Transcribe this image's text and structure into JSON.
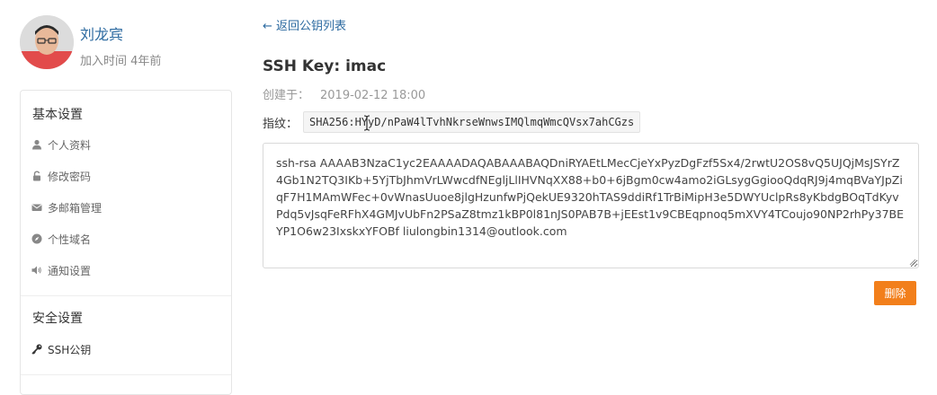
{
  "user": {
    "name": "刘龙宾",
    "joined": "加入时间 4年前"
  },
  "sidebar": {
    "basic_title": "基本设置",
    "basic_items": [
      {
        "label": "个人资料",
        "icon": "user-icon"
      },
      {
        "label": "修改密码",
        "icon": "lock-icon"
      },
      {
        "label": "多邮箱管理",
        "icon": "envelope-icon"
      },
      {
        "label": "个性域名",
        "icon": "compass-icon"
      },
      {
        "label": "通知设置",
        "icon": "volume-icon"
      }
    ],
    "security_title": "安全设置",
    "security_items": [
      {
        "label": "SSH公钥",
        "icon": "key-icon",
        "active": true
      }
    ]
  },
  "main": {
    "back_link": "← 返回公钥列表",
    "title": "SSH Key: imac",
    "created_label": "创建于：",
    "created_value": "2019-02-12 18:00",
    "fingerprint_label": "指纹：",
    "fingerprint_value": "SHA256:HYyD/nPaW4lTvhNkrseWnwsIMQlmqWmcQVsx7ahCGzs",
    "key_content": "ssh-rsa AAAAB3NzaC1yc2EAAAADAQABAAABAQDniRYAEtLMecCjeYxPyzDgFzf5Sx4/2rwtU2OS8vQ5UJQjMsJSYrZ4Gb1N2TQ3IKb+5YjTbJhmVrLWwcdfNEgljLlIHVNqXX88+b0+6jBgm0cw4amo2iGLsygGgiooQdqRJ9j4mqBVaYJpZiqF7H1MAmWFec+0vWnasUuoe8jlgHzunfwPjQekUE9320hTAS9ddiRf1TrBiMipH3e5DWYUclpRs8yKbdgBOqTdKyvPdq5vJsqFeRFhX4GMJvUbFn2PSaZ8tmz1kBP0l81nJS0PAB7B+jEEst1v9CBEqpnoq5mXVY4TCoujo90NP2rhPy37BEYP1O6w23IxskxYFOBf liulongbin1314@outlook.com",
    "delete_label": "删除"
  },
  "colors": {
    "link": "#2c6aa0",
    "delete_button": "#f27f1b"
  }
}
